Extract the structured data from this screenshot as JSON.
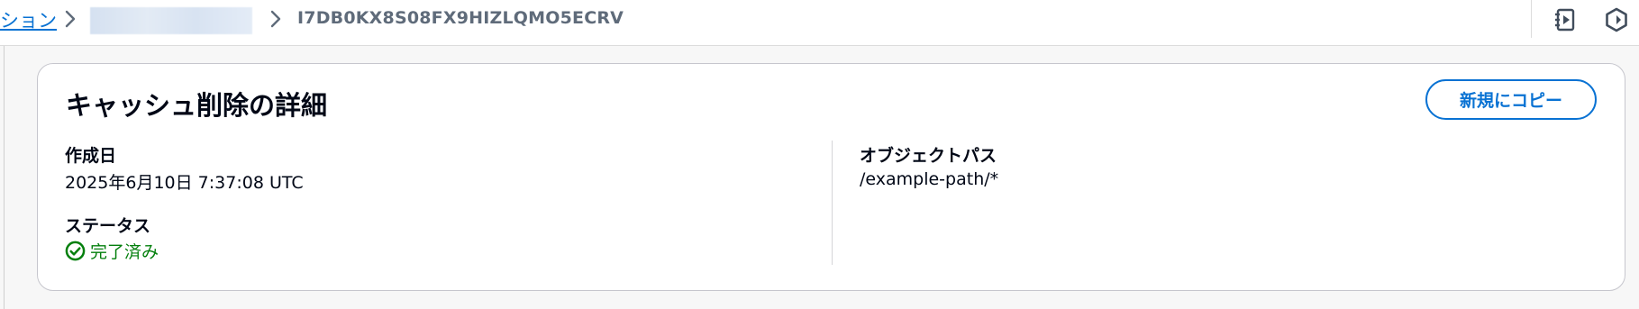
{
  "breadcrumb": {
    "previous_label": "ション",
    "current_label": "I7DB0KX8S08FX9HIZLQMO5ECRV"
  },
  "top_icons": [
    "notebook-play-icon",
    "settings-hex-icon"
  ],
  "card": {
    "title": "キャッシュ削除の詳細",
    "copy_button_label": "新規にコピー",
    "created_label": "作成日",
    "created_value": "2025年6月10日 7:37:08 UTC",
    "status_label": "ステータス",
    "status_value": "完了済み",
    "object_path_label": "オブジェクトパス",
    "object_path_value": "/example-path/*"
  },
  "colors": {
    "link": "#0972d3",
    "success": "#037f0c",
    "text": "#000716",
    "muted": "#5f6b7a"
  }
}
